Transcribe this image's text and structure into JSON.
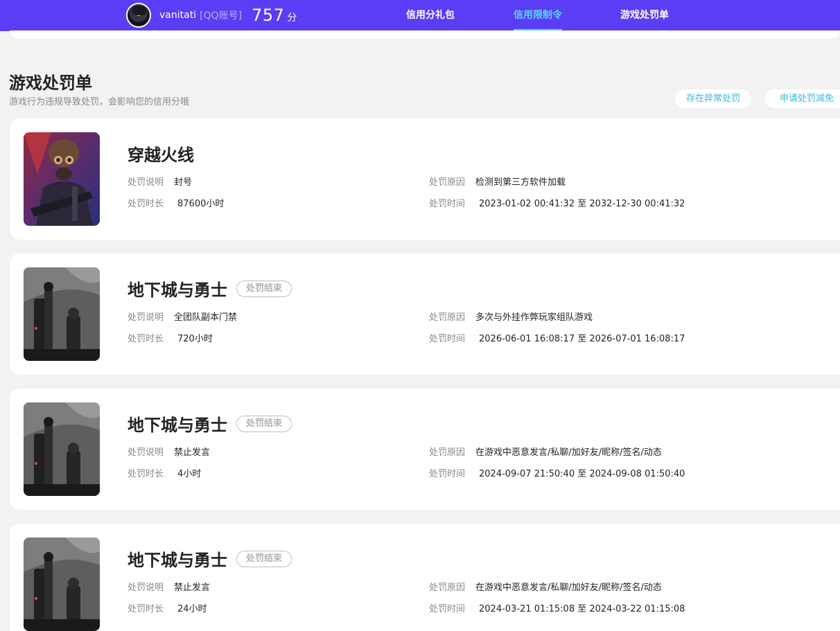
{
  "header": {
    "username": "vanitati",
    "account_type": "[QQ账号]",
    "score": "757",
    "score_unit": "分",
    "nav": [
      {
        "label": "信用分礼包",
        "active": false
      },
      {
        "label": "信用限制令",
        "active": true
      },
      {
        "label": "游戏处罚单",
        "active": false
      }
    ]
  },
  "section": {
    "title": "游戏处罚单",
    "subtitle": "游戏行为违规导致处罚，会影响您的信用分哦",
    "actions": [
      "存在异常处罚",
      "申请处罚减免"
    ]
  },
  "labels": {
    "desc": "处罚说明",
    "duration": "处罚时长",
    "reason": "处罚原因",
    "time": "处罚时间"
  },
  "penalties": [
    {
      "game": "穿越火线",
      "status": "",
      "desc": "封号",
      "duration": "87600小时",
      "reason": "检测到第三方软件加载",
      "time": "2023-01-02 00:41:32 至 2032-12-30 00:41:32",
      "image_icon": "cf-soldier-icon"
    },
    {
      "game": "地下城与勇士",
      "status": "处罚结束",
      "desc": "全团队副本门禁",
      "duration": "720小时",
      "reason": "多次与外挂作弊玩家组队游戏",
      "time": "2026-06-01 16:08:17 至 2026-07-01 16:08:17",
      "image_icon": "dnf-greyscale-icon"
    },
    {
      "game": "地下城与勇士",
      "status": "处罚结束",
      "desc": "禁止发言",
      "duration": "4小时",
      "reason": "在游戏中恶意发言/私聊/加好友/昵称/签名/动态",
      "time": "2024-09-07 21:50:40 至 2024-09-08 01:50:40",
      "image_icon": "dnf-greyscale-icon"
    },
    {
      "game": "地下城与勇士",
      "status": "处罚结束",
      "desc": "禁止发言",
      "duration": "24小时",
      "reason": "在游戏中恶意发言/私聊/加好友/昵称/签名/动态",
      "time": "2024-03-21 01:15:08 至 2024-03-22 01:15:08",
      "image_icon": "dnf-greyscale-icon"
    }
  ]
}
